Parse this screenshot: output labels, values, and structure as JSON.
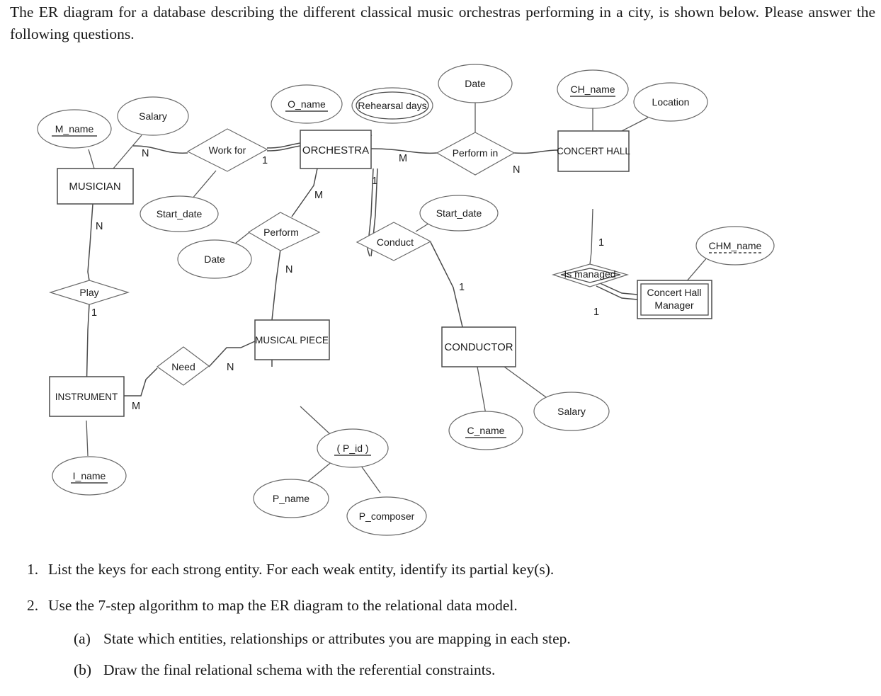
{
  "intro": {
    "text": "The ER diagram for a database describing the different classical music orchestras performing in a city, is shown below. Please answer the following questions."
  },
  "diagram": {
    "title": "ER diagram of classical music orchestras database",
    "entities": [
      {
        "id": "musician",
        "label": "MUSICIAN",
        "kind": "strong"
      },
      {
        "id": "orchestra",
        "label": "ORCHESTRA",
        "kind": "strong"
      },
      {
        "id": "concert_hall",
        "label": "CONCERT HALL",
        "kind": "strong"
      },
      {
        "id": "musical_piece",
        "label": "MUSICAL PIECE",
        "kind": "strong"
      },
      {
        "id": "conductor",
        "label": "CONDUCTOR",
        "kind": "strong"
      },
      {
        "id": "instrument",
        "label": "INSTRUMENT",
        "kind": "strong"
      },
      {
        "id": "chm_line1",
        "label": "Concert Hall",
        "kind": "weak"
      },
      {
        "id": "chm_line2",
        "label": "Manager",
        "kind": "weak"
      }
    ],
    "relationships": [
      {
        "id": "work_for",
        "label": "Work for",
        "kind": "normal"
      },
      {
        "id": "perform_in",
        "label": "Perform in",
        "kind": "normal"
      },
      {
        "id": "perform",
        "label": "Perform",
        "kind": "normal"
      },
      {
        "id": "conduct",
        "label": "Conduct",
        "kind": "normal"
      },
      {
        "id": "play",
        "label": "Play",
        "kind": "normal"
      },
      {
        "id": "need",
        "label": "Need",
        "kind": "normal"
      },
      {
        "id": "is_managed",
        "label": "Is managed",
        "kind": "identifying"
      }
    ],
    "attributes": [
      {
        "id": "m_name",
        "label": "M_name",
        "kind": "key"
      },
      {
        "id": "musician_salary",
        "label": "Salary",
        "kind": "simple"
      },
      {
        "id": "o_name",
        "label": "O_name",
        "kind": "key"
      },
      {
        "id": "rehearsal_days",
        "label": "Rehearsal days",
        "kind": "multivalued"
      },
      {
        "id": "performin_date",
        "label": "Date",
        "kind": "simple"
      },
      {
        "id": "ch_name",
        "label": "CH_name",
        "kind": "key"
      },
      {
        "id": "location",
        "label": "Location",
        "kind": "simple"
      },
      {
        "id": "workfor_start_date",
        "label": "Start_date",
        "kind": "simple"
      },
      {
        "id": "perform_date",
        "label": "Date",
        "kind": "simple"
      },
      {
        "id": "conduct_start_date",
        "label": "Start_date",
        "kind": "simple"
      },
      {
        "id": "chm_name",
        "label": "CHM_name",
        "kind": "partial-key"
      },
      {
        "id": "p_id",
        "label": "( P_id )",
        "kind": "key"
      },
      {
        "id": "p_name",
        "label": "P_name",
        "kind": "simple"
      },
      {
        "id": "p_composer",
        "label": "P_composer",
        "kind": "simple"
      },
      {
        "id": "c_name",
        "label": "C_name",
        "kind": "key"
      },
      {
        "id": "conductor_salary",
        "label": "Salary",
        "kind": "simple"
      },
      {
        "id": "i_name",
        "label": "I_name",
        "kind": "key"
      }
    ],
    "cardinalities": [
      {
        "id": "musician_workfor",
        "label": "N"
      },
      {
        "id": "workfor_orchestra",
        "label": "1"
      },
      {
        "id": "orchestra_performin",
        "label": "M"
      },
      {
        "id": "performin_hall",
        "label": "N"
      },
      {
        "id": "orchestra_perform",
        "label": "M"
      },
      {
        "id": "perform_piece",
        "label": "N"
      },
      {
        "id": "orchestra_conduct",
        "label": "1"
      },
      {
        "id": "conduct_conductor",
        "label": "1"
      },
      {
        "id": "musician_play",
        "label": "N"
      },
      {
        "id": "play_instrument",
        "label": "1"
      },
      {
        "id": "instrument_need",
        "label": "M"
      },
      {
        "id": "need_piece",
        "label": "N"
      },
      {
        "id": "hall_ismanaged",
        "label": "1"
      },
      {
        "id": "ismanaged_chm",
        "label": "1"
      }
    ]
  },
  "questions": [
    {
      "number": "1.",
      "text": "List the keys for each strong entity. For each weak entity, identify its partial key(s)."
    },
    {
      "number": "2.",
      "text": "Use the 7-step algorithm to map the ER diagram to the relational data model.",
      "subitems": [
        {
          "number": "(a)",
          "text": "State which entities, relationships or attributes you are mapping in each step."
        },
        {
          "number": "(b)",
          "text": "Draw the final relational schema with the referential constraints."
        }
      ]
    }
  ]
}
